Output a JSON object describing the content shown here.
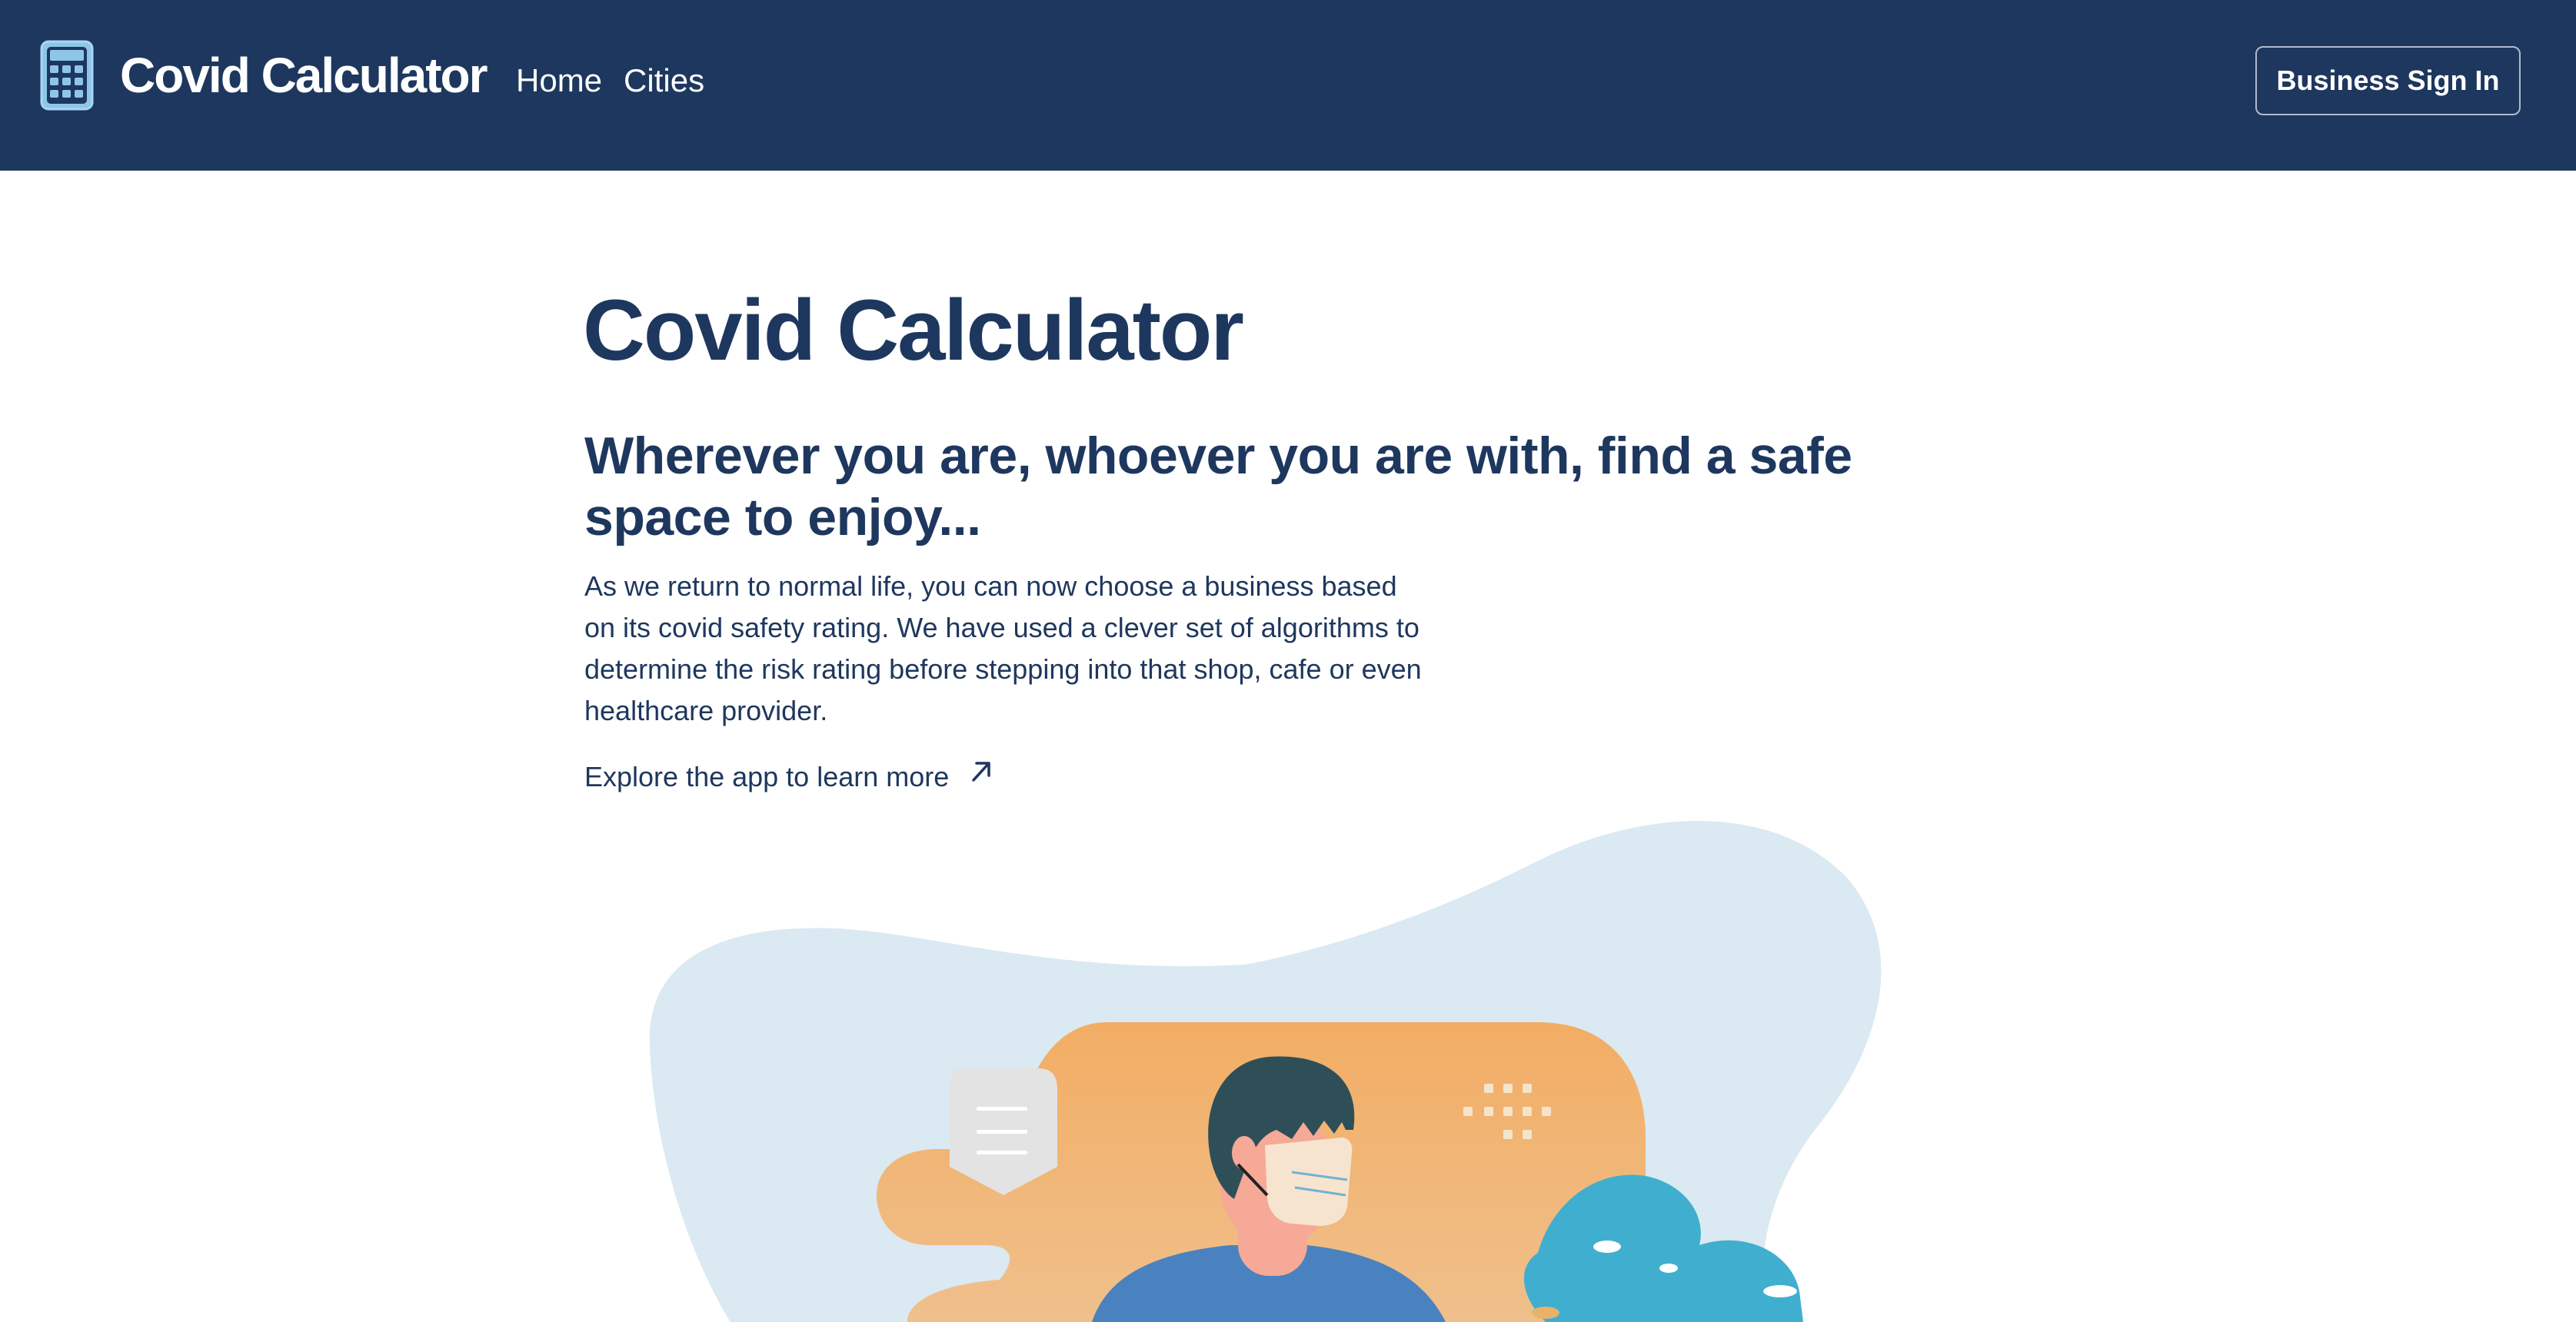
{
  "navbar": {
    "brand_icon": "calculator-icon",
    "brand_title": "Covid Calculator",
    "links": [
      {
        "label": "Home"
      },
      {
        "label": "Cities"
      }
    ],
    "signin_label": "Business Sign In"
  },
  "hero": {
    "title": "Covid Calculator",
    "subtitle": "Wherever you are, whoever you are with, find a safe space to enjoy...",
    "body": "As we return to normal life, you can now choose a business based on its covid safety rating. We have used a clever set of algorithms to determine the risk rating before stepping into that shop, cafe or even healthcare provider.",
    "explore_label": "Explore the app to learn more",
    "explore_icon": "arrow-up-right-icon"
  },
  "illustration": {
    "icon": "masked-person-illustration"
  },
  "colors": {
    "navbar": "#1e375e",
    "text": "#1e375e",
    "blob": "#dae9f2",
    "orange": "#f1b06a",
    "plant": "#40afcf"
  }
}
